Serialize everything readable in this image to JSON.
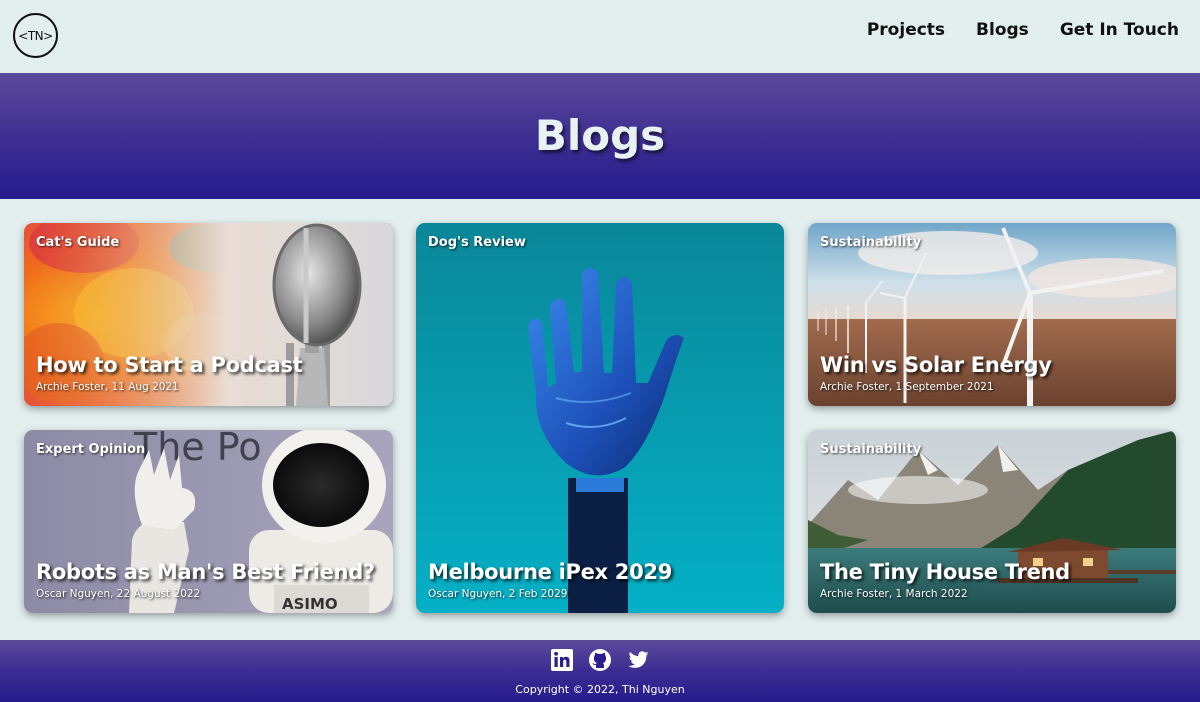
{
  "brand": {
    "logo_text": "<TN>"
  },
  "nav": {
    "items": [
      "Projects",
      "Blogs",
      "Get In Touch"
    ]
  },
  "hero": {
    "title": "Blogs"
  },
  "cards": [
    {
      "category": "Cat's Guide",
      "title": "How to Start a Podcast",
      "meta": "Archie Foster, 11 Aug 2021"
    },
    {
      "category": "Dog's Review",
      "title": "Melbourne iPex 2029",
      "meta": "Oscar Nguyen, 2 Feb 2029"
    },
    {
      "category": "Sustainability",
      "title": "Win vs Solar Energy",
      "meta": "Archie Foster, 1 September 2021"
    },
    {
      "category": "Expert Opinion",
      "title": "Robots as Man's Best Friend?",
      "meta": "Oscar Nguyen, 22 August 2022"
    },
    {
      "category": "Sustainability",
      "title": "The Tiny House Trend",
      "meta": "Archie Foster, 1 March 2022"
    }
  ],
  "card_art_text": {
    "robot_chest": "ASIMO",
    "poster_backdrop": "The Po"
  },
  "footer": {
    "icons": [
      "linkedin-icon",
      "github-icon",
      "twitter-icon"
    ],
    "copyright": "Copyright © 2022, Thi Nguyen"
  },
  "colors": {
    "page_bg": "#e3efef",
    "banner_top": "#5a4a9a",
    "banner_bottom": "#261a8c",
    "text_dark": "#111111"
  }
}
